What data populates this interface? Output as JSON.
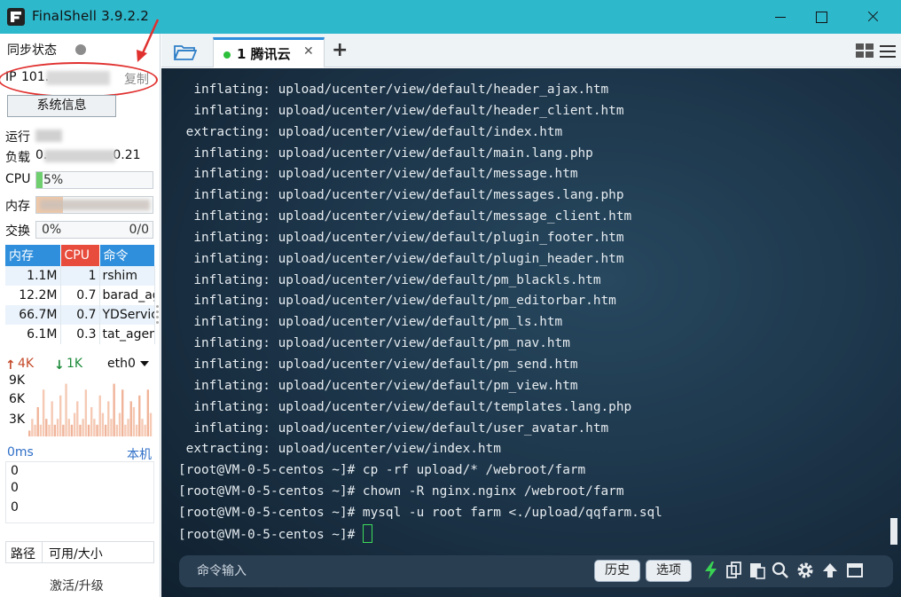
{
  "window": {
    "title": "FinalShell 3.9.2.2",
    "icon": "finalshell-app-icon"
  },
  "sidebar": {
    "sync_label": "同步状态",
    "ip_label": "IP",
    "ip_visible": "101.",
    "copy_label": "复制",
    "sysinfo_label": "系统信息",
    "run_label": "运行",
    "load_label": "负载",
    "load_visible": "0.",
    "load_tail": "0.21",
    "cpu_label": "CPU",
    "cpu_percent": 5,
    "cpu_text": "5%",
    "mem_label": "内存",
    "mem_fraction": 0.23,
    "swap_label": "交换",
    "swap_text": "0%",
    "swap_right": "0/0",
    "process_headers": [
      "内存",
      "CPU",
      "命令"
    ],
    "processes": [
      {
        "mem": "1.1M",
        "cpu": "1",
        "cmd": "rshim"
      },
      {
        "mem": "12.2M",
        "cpu": "0.7",
        "cmd": "barad_agent"
      },
      {
        "mem": "66.7M",
        "cpu": "0.7",
        "cmd": "YDService"
      },
      {
        "mem": "6.1M",
        "cpu": "0.3",
        "cmd": "tat_agent"
      }
    ],
    "net_up": "4K",
    "net_down": "1K",
    "net_iface": "eth0",
    "net_yticks": [
      "9K",
      "6K",
      "3K"
    ],
    "net_series": [
      1,
      3,
      2,
      5,
      2,
      8,
      3,
      2,
      6,
      2,
      3,
      7,
      2,
      9,
      3,
      2,
      4,
      6,
      2,
      3,
      8,
      2,
      5,
      3,
      2,
      7,
      4,
      2,
      6,
      3,
      9,
      2,
      4,
      8,
      2,
      3,
      6,
      5,
      2,
      7,
      3,
      2,
      8,
      4
    ],
    "latency_label": "0ms",
    "latency_host": "本机",
    "latency_values": [
      "0",
      "0",
      "0"
    ],
    "path_label": "路径",
    "size_label": "可用/大小",
    "activate_label": "激活/升级",
    "accent_blue": "#2f8fdc",
    "accent_red": "#e74c3c",
    "annotation_color": "#e0312f"
  },
  "tabs": {
    "folder_icon": "folder-icon",
    "active_label": "1 腾讯云",
    "close_glyph": "✕",
    "add_glyph": "+",
    "status_color": "#2bbf3a"
  },
  "terminal": {
    "lines": [
      "  inflating: upload/ucenter/view/default/header_ajax.htm",
      "  inflating: upload/ucenter/view/default/header_client.htm",
      " extracting: upload/ucenter/view/default/index.htm",
      "  inflating: upload/ucenter/view/default/main.lang.php",
      "  inflating: upload/ucenter/view/default/message.htm",
      "  inflating: upload/ucenter/view/default/messages.lang.php",
      "  inflating: upload/ucenter/view/default/message_client.htm",
      "  inflating: upload/ucenter/view/default/plugin_footer.htm",
      "  inflating: upload/ucenter/view/default/plugin_header.htm",
      "  inflating: upload/ucenter/view/default/pm_blackls.htm",
      "  inflating: upload/ucenter/view/default/pm_editorbar.htm",
      "  inflating: upload/ucenter/view/default/pm_ls.htm",
      "  inflating: upload/ucenter/view/default/pm_nav.htm",
      "  inflating: upload/ucenter/view/default/pm_send.htm",
      "  inflating: upload/ucenter/view/default/pm_view.htm",
      "  inflating: upload/ucenter/view/default/templates.lang.php",
      "  inflating: upload/ucenter/view/default/user_avatar.htm",
      " extracting: upload/ucenter/view/index.htm",
      "[root@VM-0-5-centos ~]# cp -rf upload/* /webroot/farm",
      "[root@VM-0-5-centos ~]# chown -R nginx.nginx /webroot/farm",
      "[root@VM-0-5-centos ~]# mysql -u root farm <./upload/qqfarm.sql"
    ],
    "prompt": "[root@VM-0-5-centos ~]# "
  },
  "cmdbar": {
    "placeholder": "命令输入",
    "history_label": "历史",
    "options_label": "选项"
  }
}
